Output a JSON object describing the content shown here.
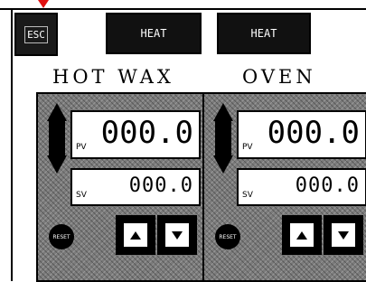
{
  "toolbar": {
    "esc_label": "ESC",
    "heat1_label": "HEAT",
    "heat2_label": "HEAT"
  },
  "panels": [
    {
      "title": "HOT WAX",
      "pv_label": "PV",
      "pv_value": "000.0",
      "sv_label": "SV",
      "sv_value": "000.0",
      "reset_label": "RESET"
    },
    {
      "title": "OVEN",
      "pv_label": "PV",
      "pv_value": "000.0",
      "sv_label": "SV",
      "sv_value": "000.0",
      "reset_label": "RESET"
    }
  ],
  "colors": {
    "marker": "#e01010",
    "panel_bg": "#7b7b7b"
  },
  "icons": [
    "up-down-arrow-icon",
    "up-arrow-icon",
    "down-arrow-icon",
    "reset-icon"
  ]
}
